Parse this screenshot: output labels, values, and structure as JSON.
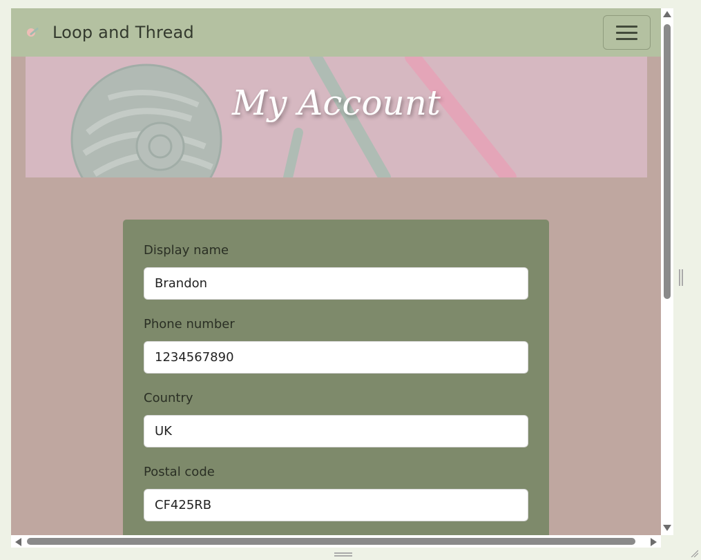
{
  "navbar": {
    "brand_text": "Loop and Thread",
    "logo_icon": "yarn-hook-logo",
    "toggle_icon": "hamburger-menu-icon"
  },
  "hero": {
    "title": "My Account"
  },
  "form": {
    "fields": [
      {
        "label": "Display name",
        "value": "Brandon"
      },
      {
        "label": "Phone number",
        "value": "1234567890"
      },
      {
        "label": "Country",
        "value": "UK"
      },
      {
        "label": "Postal code",
        "value": "CF425RB"
      }
    ]
  },
  "colors": {
    "navbar_bg": "#b4c1a1",
    "page_bg": "#bfa7a0",
    "card_bg": "#7e8a6b",
    "hero_bg": "#d9b8c0"
  }
}
